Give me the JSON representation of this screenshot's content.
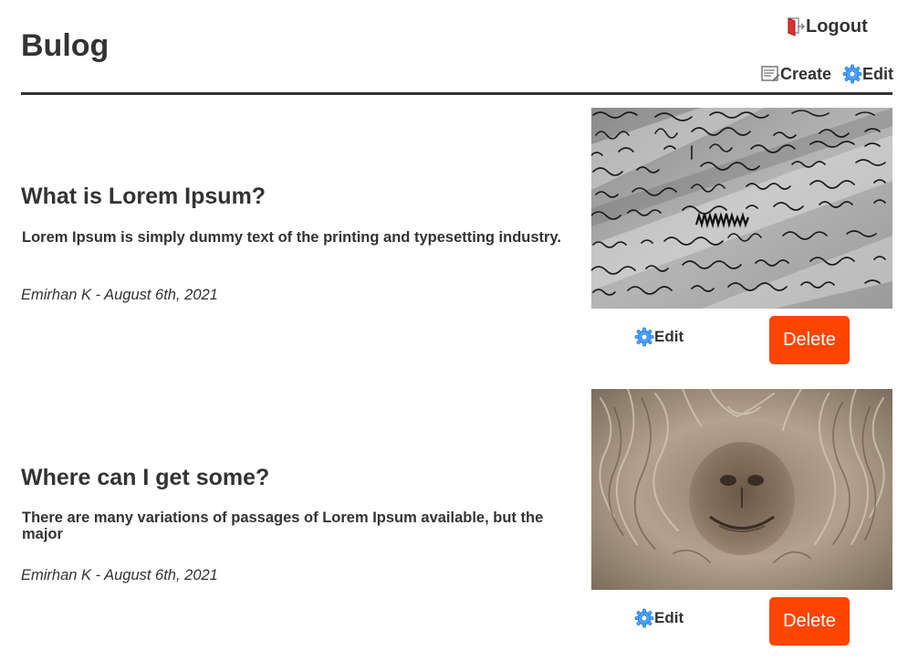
{
  "header": {
    "site_title": "Bulog",
    "logout_label": "Logout",
    "create_label": "Create",
    "edit_label": "Edit"
  },
  "posts": [
    {
      "title": "What is Lorem Ipsum?",
      "summary": "Lorem Ipsum is simply dummy text of the printing and typesetting industry.",
      "meta": "Emirhan K - August 6th, 2021",
      "image_icon": "handwriting-photo",
      "edit_label": "Edit",
      "delete_label": "Delete"
    },
    {
      "title": "Where can I get some?",
      "summary": "There are many variations of passages of Lorem Ipsum available, but the major",
      "meta": "Emirhan K - August 6th, 2021",
      "image_icon": "alpaca-photo",
      "edit_label": "Edit",
      "delete_label": "Delete"
    }
  ],
  "colors": {
    "text": "#333333",
    "delete_button": "#ff4500",
    "gear_icon": "#3399ff"
  }
}
